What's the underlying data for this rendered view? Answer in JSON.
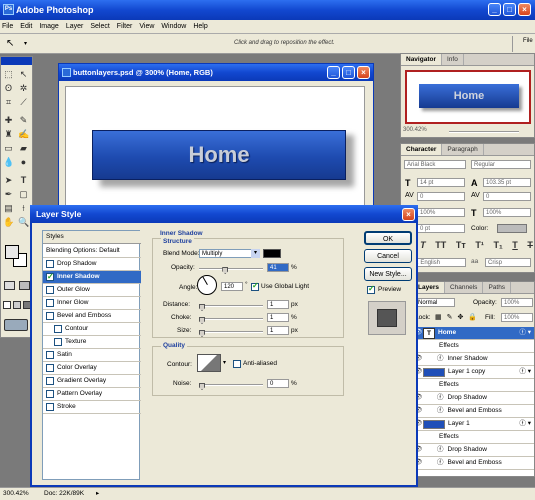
{
  "app": {
    "title": "Adobe Photoshop"
  },
  "menu": [
    "File",
    "Edit",
    "Image",
    "Layer",
    "Select",
    "Filter",
    "View",
    "Window",
    "Help"
  ],
  "options_bar": {
    "hint": "Click and drag to reposition the effect."
  },
  "file_label": "File",
  "document": {
    "title": "buttonlayers.psd @ 300% (Home, RGB)",
    "button_text": "Home"
  },
  "navigator": {
    "tabs": [
      "Navigator",
      "Info"
    ],
    "thumb_text": "Home",
    "zoom": "300.42%"
  },
  "character": {
    "tabs": [
      "Character",
      "Paragraph"
    ],
    "font_family": "Arial Black",
    "font_style": "Regular",
    "size": "14 pt",
    "leading": "103.35 pt",
    "kerning": "0",
    "tracking": "0",
    "vscale": "100%",
    "hscale": "100%",
    "baseline": "0 pt",
    "color_label": "Color:",
    "language": "U.S. English",
    "aa_prefix": "aa",
    "antialias": "Crisp"
  },
  "layers": {
    "tabs": [
      "Layers",
      "Channels",
      "Paths"
    ],
    "blend": "Normal",
    "opacity_label": "Opacity:",
    "opacity": "100%",
    "lock_label": "Lock:",
    "fill_label": "Fill:",
    "fill": "100%",
    "rows": [
      {
        "kind": "layer",
        "name": "Home",
        "icon": "T",
        "selected": true
      },
      {
        "kind": "effects",
        "name": "Effects"
      },
      {
        "kind": "effect",
        "name": "Inner Shadow"
      },
      {
        "kind": "layer",
        "name": "Layer 1 copy"
      },
      {
        "kind": "effects",
        "name": "Effects"
      },
      {
        "kind": "effect",
        "name": "Drop Shadow"
      },
      {
        "kind": "effect",
        "name": "Bevel and Emboss"
      },
      {
        "kind": "layer",
        "name": "Layer 1"
      },
      {
        "kind": "effects",
        "name": "Effects"
      },
      {
        "kind": "effect",
        "name": "Drop Shadow"
      },
      {
        "kind": "effect",
        "name": "Bevel and Emboss"
      }
    ]
  },
  "status": {
    "zoom": "300.42%",
    "doc": "Doc: 22K/89K"
  },
  "dialog": {
    "title": "Layer Style",
    "styles_header": "Styles",
    "styles": [
      {
        "label": "Blending Options: Default",
        "checkbox": false
      },
      {
        "label": "Drop Shadow",
        "checkbox": true,
        "checked": false
      },
      {
        "label": "Inner Shadow",
        "checkbox": true,
        "checked": true,
        "selected": true
      },
      {
        "label": "Outer Glow",
        "checkbox": true,
        "checked": false
      },
      {
        "label": "Inner Glow",
        "checkbox": true,
        "checked": false
      },
      {
        "label": "Bevel and Emboss",
        "checkbox": true,
        "checked": false
      },
      {
        "label": "Contour",
        "checkbox": true,
        "checked": false,
        "indent": true
      },
      {
        "label": "Texture",
        "checkbox": true,
        "checked": false,
        "indent": true
      },
      {
        "label": "Satin",
        "checkbox": true,
        "checked": false
      },
      {
        "label": "Color Overlay",
        "checkbox": true,
        "checked": false
      },
      {
        "label": "Gradient Overlay",
        "checkbox": true,
        "checked": false
      },
      {
        "label": "Pattern Overlay",
        "checkbox": true,
        "checked": false
      },
      {
        "label": "Stroke",
        "checkbox": true,
        "checked": false
      }
    ],
    "section_title": "Inner Shadow",
    "structure_title": "Structure",
    "blend_mode_label": "Blend Mode:",
    "blend_mode": "Multiply",
    "opacity_label": "Opacity:",
    "opacity": "41",
    "opacity_pct": 0.41,
    "angle_label": "Angle:",
    "angle": "120",
    "use_global_light": "Use Global Light",
    "distance_label": "Distance:",
    "distance": "1",
    "choke_label": "Choke:",
    "choke": "1",
    "size_label": "Size:",
    "size": "1",
    "px": "px",
    "pct": "%",
    "deg": "°",
    "quality_title": "Quality",
    "contour_label": "Contour:",
    "anti_aliased": "Anti-aliased",
    "noise_label": "Noise:",
    "noise": "0",
    "buttons": {
      "ok": "OK",
      "cancel": "Cancel",
      "new_style": "New Style..."
    },
    "preview_label": "Preview"
  },
  "colors": {
    "button_blue": "#1f4fb8",
    "xp_title": "#0b39b8",
    "selection": "#316ac5"
  }
}
